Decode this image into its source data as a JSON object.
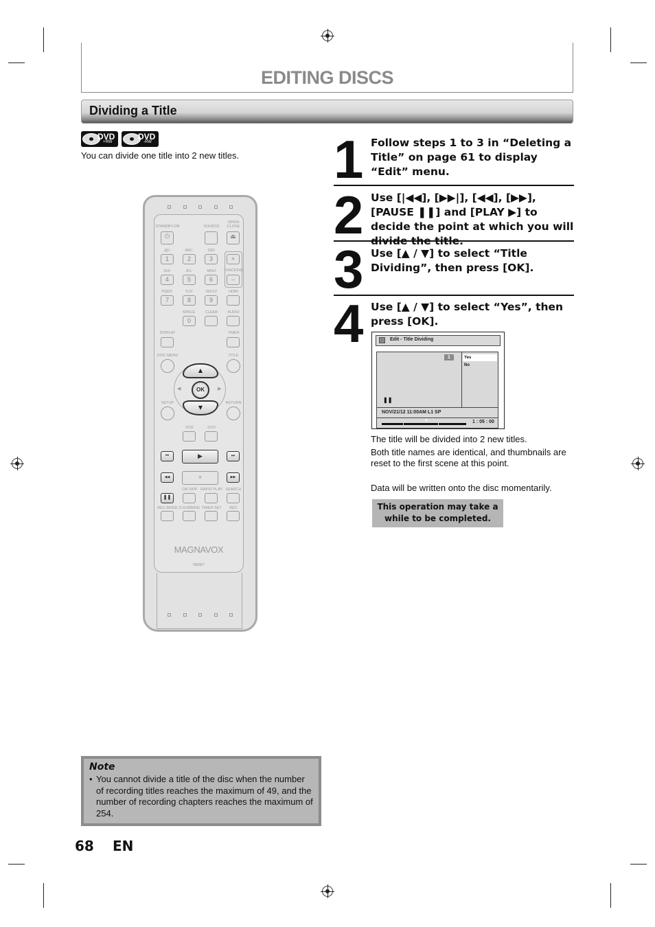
{
  "header": {
    "title": "EDITING DISCS",
    "section_title": "Dividing a Title"
  },
  "disc_badges": [
    {
      "label": "DVD",
      "sub": "+RW"
    },
    {
      "label": "DVD",
      "sub": "-RW"
    }
  ],
  "intro": "You can divide one title into 2 new titles.",
  "remote": {
    "brand": "MAGNAVOX",
    "model": "NB887",
    "labels": {
      "standby": "STANDBY-ON",
      "source": "SOURCE",
      "open_close": "OPEN/ CLOSE",
      "k1": ".@/:",
      "k2": "ABC",
      "k3": "DEF",
      "k4": "GHI",
      "k5": "JKL",
      "k6": "MNO",
      "k7": "PQRS",
      "k8": "TUV",
      "k9": "WXYZ",
      "tracking": "TRACKING",
      "hdmi": "HDMI",
      "space": "SPACE",
      "clear": "CLEAR",
      "audio": "AUDIO",
      "display": "DISPLAY",
      "timer": "TIMER",
      "disc_menu": "DISC MENU",
      "title": "TITLE",
      "setup": "SETUP",
      "return": "RETURN",
      "vcr": "VCR",
      "dvd": "DVD",
      "cm_skip": "CM SKIP",
      "rapid_play": "RAPID PLAY",
      "search": "SEARCH",
      "rec_mode": "REC MODE",
      "d_dubbing": "D.DUBBING",
      "timer_set": "TIMER SET",
      "rec": "REC"
    },
    "keys": {
      "n1": "1",
      "n2": "2",
      "n3": "3",
      "n4": "4",
      "n5": "5",
      "n6": "6",
      "n7": "7",
      "n8": "8",
      "n9": "9",
      "n0": "0",
      "plus": "+",
      "minus": "–",
      "power": "⏻",
      "eject": "⏏",
      "ok": "OK",
      "up": "▲",
      "down": "▼",
      "left": "◀",
      "right": "▶",
      "skip_back": "⏮",
      "play": "▶",
      "skip_fwd": "⏭",
      "rewind": "◀◀",
      "stop": "■",
      "ffwd": "▶▶",
      "pause": "❚❚"
    }
  },
  "steps": [
    {
      "num": "1",
      "text": "Follow steps 1 to 3 in “Deleting a Title” on page 61 to display “Edit” menu."
    },
    {
      "num": "2",
      "text": "Use [|◀◀], [▶▶|], [◀◀], [▶▶], [PAUSE ❚❚] and [PLAY ▶] to decide the point at which you will divide the title."
    },
    {
      "num": "3",
      "text": "Use [▲ / ▼] to select “Title Dividing”, then press [OK]."
    },
    {
      "num": "4",
      "text": "Use [▲ / ▼] to select “Yes”, then press [OK]."
    }
  ],
  "osd": {
    "title": "Edit - Title Dividing",
    "title_number": "1",
    "options": [
      "Yes",
      "No"
    ],
    "selected_option": "Yes",
    "pause_symbol": "❚❚",
    "info": "NOV/21/12 11:00AM L1 SP",
    "time": "1 : 05 : 00"
  },
  "after_step": {
    "line1": "The title will be divided into 2 new titles.",
    "line2": "Both title names are identical, and thumbnails are reset to the first scene at this point.",
    "line3": "Data will be written onto the disc momentarily.",
    "callout": "This operation may take a while to be completed."
  },
  "note": {
    "title": "Note",
    "items": [
      "You cannot divide a title of the disc when the number of recording titles reaches the maximum of 49, and the number of recording chapters reaches the maximum of 254."
    ]
  },
  "footer": {
    "page_number": "68",
    "language": "EN"
  }
}
